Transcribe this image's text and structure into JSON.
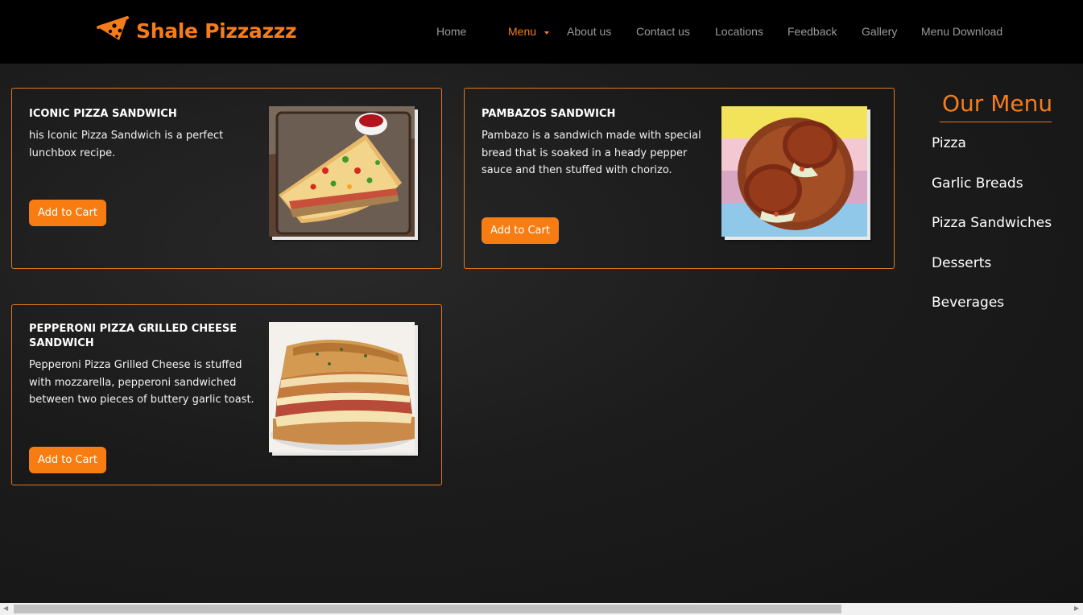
{
  "brand": {
    "name": "Shale Pizzazzz",
    "icon": "pizza-slice-icon"
  },
  "nav": {
    "items": [
      "Home",
      "Menu",
      "About us",
      "Contact us",
      "Locations",
      "Feedback",
      "Gallery",
      "Menu Download"
    ],
    "active": "Menu"
  },
  "products": [
    {
      "title": "ICONIC PIZZA SANDWICH",
      "description": "his Iconic Pizza Sandwich is a perfect lunchbox recipe.",
      "button": "Add to Cart"
    },
    {
      "title": "PAMBAZOS SANDWICH",
      "description": "Pambazo is a sandwich made with special bread that is soaked in a heady pepper sauce and then stuffed with chorizo.",
      "button": "Add to Cart"
    },
    {
      "title": "PEPPERONI PIZZA GRILLED CHEESE SANDWICH",
      "description": "Pepperoni Pizza Grilled Cheese is stuffed with mozzarella, pepperoni sandwiched between two pieces of buttery garlic toast.",
      "button": "Add to Cart"
    }
  ],
  "sidebar": {
    "title": "Our Menu",
    "items": [
      "Pizza",
      "Garlic Breads",
      "Pizza Sandwiches",
      "Desserts",
      "Beverages"
    ]
  },
  "colors": {
    "accent": "#f57c1a",
    "navbar": "#000000",
    "background": "#1c1c1c"
  }
}
